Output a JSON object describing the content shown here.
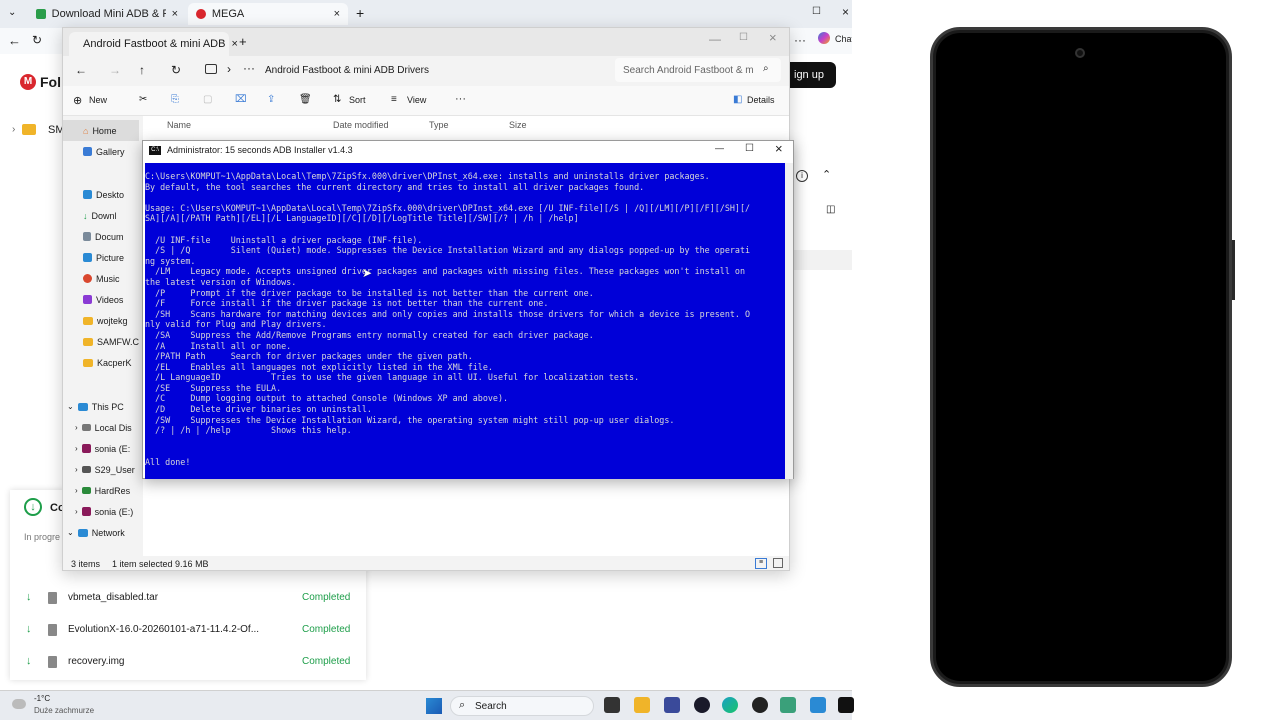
{
  "browser": {
    "tabs": [
      {
        "label": "Download Mini ADB & Fastboot w"
      },
      {
        "label": "MEGA"
      }
    ],
    "new_tab": "+",
    "chat_label": "Chat",
    "sign_up": "ign up",
    "mega_prefix": "Fol",
    "mega_side": "SM",
    "downloads": {
      "header": "Co",
      "in_progress": "In progre",
      "items": [
        {
          "name": "vbmeta_disabled.tar",
          "status": "Completed"
        },
        {
          "name": "EvolutionX-16.0-20260101-a71-11.4.2-Of...",
          "status": "Completed"
        },
        {
          "name": "recovery.img",
          "status": "Completed"
        }
      ]
    }
  },
  "explorer": {
    "tab_title": "Android Fastboot & mini ADB",
    "breadcrumb": "Android Fastboot & mini ADB Drivers",
    "search_placeholder": "Search Android Fastboot & mini",
    "toolbar": {
      "new": "New",
      "sort": "Sort",
      "view": "View",
      "more": "···",
      "details": "Details"
    },
    "columns": [
      "Name",
      "Date modified",
      "Type",
      "Size"
    ],
    "sidebar": [
      {
        "label": "Home"
      },
      {
        "label": "Gallery"
      },
      {
        "label": "Deskto"
      },
      {
        "label": "Downl"
      },
      {
        "label": "Docum"
      },
      {
        "label": "Picture"
      },
      {
        "label": "Music"
      },
      {
        "label": "Videos"
      },
      {
        "label": "wojtekg"
      },
      {
        "label": "SAMFW.C"
      },
      {
        "label": "KacperK"
      },
      {
        "label": "This PC"
      },
      {
        "label": "Local Dis"
      },
      {
        "label": "sonia (E:"
      },
      {
        "label": "S29_User"
      },
      {
        "label": "HardRes"
      },
      {
        "label": "sonia (E:)"
      },
      {
        "label": "Network"
      }
    ],
    "status": {
      "items": "3 items",
      "selected": "1 item selected  9.16 MB"
    }
  },
  "console": {
    "title": "Administrator:  15 seconds ADB Installer v1.4.3",
    "lines": [
      "C:\\Users\\KOMPUT~1\\AppData\\Local\\Temp\\7ZipSfx.000\\driver\\DPInst_x64.exe: installs and uninstalls driver packages.",
      "By default, the tool searches the current directory and tries to install all driver packages found.",
      "",
      "Usage: C:\\Users\\KOMPUT~1\\AppData\\Local\\Temp\\7ZipSfx.000\\driver\\DPInst_x64.exe [/U INF-file][/S | /Q][/LM][/P][/F][/SH][/",
      "SA][/A][/PATH Path][/EL][/L LanguageID][/C][/D][/LogTitle Title][/SW][/? | /h | /help]",
      "",
      "  /U INF-file    Uninstall a driver package (INF-file).",
      "  /S | /Q        Silent (Quiet) mode. Suppresses the Device Installation Wizard and any dialogs popped-up by the operati",
      "ng system.",
      "  /LM    Legacy mode. Accepts unsigned driver packages and packages with missing files. These packages won't install on",
      "the latest version of Windows.",
      "  /P     Prompt if the driver package to be installed is not better than the current one.",
      "  /F     Force install if the driver package is not better than the current one.",
      "  /SH    Scans hardware for matching devices and only copies and installs those drivers for which a device is present. O",
      "nly valid for Plug and Play drivers.",
      "  /SA    Suppress the Add/Remove Programs entry normally created for each driver package.",
      "  /A     Install all or none.",
      "  /PATH Path     Search for driver packages under the given path.",
      "  /EL    Enables all languages not explicitly listed in the XML file.",
      "  /L LanguageID          Tries to use the given language in all UI. Useful for localization tests.",
      "  /SE    Suppress the EULA.",
      "  /C     Dump logging output to attached Console (Windows XP and above).",
      "  /D     Delete driver binaries on uninstall.",
      "  /SW    Suppresses the Device Installation Wizard, the operating system might still pop-up user dialogs.",
      "  /? | /h | /help        Shows this help.",
      "",
      "",
      "All done!"
    ]
  },
  "taskbar": {
    "weather_temp": "-1°C",
    "weather_desc": "Duże zachmurze",
    "search": "Search"
  },
  "colors": {
    "console_bg": "#0000d8",
    "mega_red": "#d9272e",
    "download_green": "#1e9e4a"
  }
}
